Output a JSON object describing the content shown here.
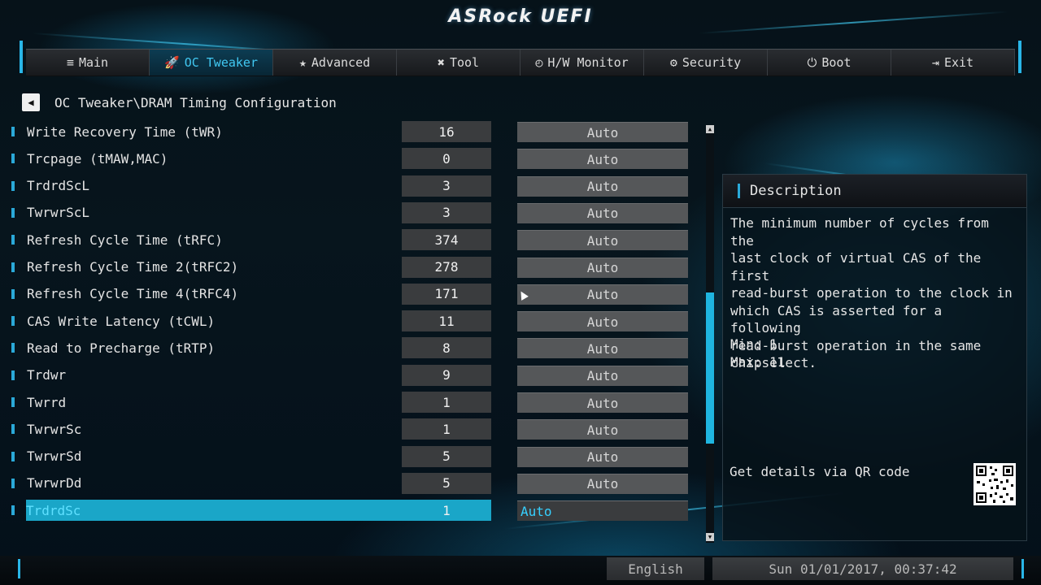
{
  "header": {
    "logo": "ASRock UEFI"
  },
  "tabs": [
    {
      "label": "Main",
      "icon": "≡",
      "active": false
    },
    {
      "label": "OC Tweaker",
      "icon": "🚀",
      "active": true
    },
    {
      "label": "Advanced",
      "icon": "★",
      "active": false
    },
    {
      "label": "Tool",
      "icon": "✖",
      "active": false
    },
    {
      "label": "H/W Monitor",
      "icon": "◴",
      "active": false
    },
    {
      "label": "Security",
      "icon": "⚙",
      "active": false
    },
    {
      "label": "Boot",
      "icon": "⏻",
      "active": false
    },
    {
      "label": "Exit",
      "icon": "⇥",
      "active": false
    }
  ],
  "breadcrumb": {
    "path": "OC Tweaker\\DRAM Timing Configuration"
  },
  "settings": [
    {
      "label": "Write Recovery Time (tWR)",
      "value": "16",
      "option": "Auto"
    },
    {
      "label": "Trcpage (tMAW,MAC)",
      "value": "0",
      "option": "Auto"
    },
    {
      "label": "TrdrdScL",
      "value": "3",
      "option": "Auto"
    },
    {
      "label": "TwrwrScL",
      "value": "3",
      "option": "Auto"
    },
    {
      "label": "Refresh Cycle Time  (tRFC)",
      "value": "374",
      "option": "Auto"
    },
    {
      "label": "Refresh Cycle Time 2(tRFC2)",
      "value": "278",
      "option": "Auto"
    },
    {
      "label": "Refresh Cycle Time 4(tRFC4)",
      "value": "171",
      "option": "Auto"
    },
    {
      "label": "CAS Write Latency (tCWL)",
      "value": "11",
      "option": "Auto"
    },
    {
      "label": "Read to Precharge (tRTP)",
      "value": "8",
      "option": "Auto"
    },
    {
      "label": "Trdwr",
      "value": "9",
      "option": "Auto"
    },
    {
      "label": "Twrrd",
      "value": "1",
      "option": "Auto"
    },
    {
      "label": "TwrwrSc",
      "value": "1",
      "option": "Auto"
    },
    {
      "label": "TwrwrSd",
      "value": "5",
      "option": "Auto"
    },
    {
      "label": "TwrwrDd",
      "value": "5",
      "option": "Auto"
    },
    {
      "label": "TrdrdSc",
      "value": "1",
      "option": "Auto",
      "selected": true
    }
  ],
  "description": {
    "title": "Description",
    "text": "The minimum number of cycles from the\nlast clock of virtual CAS of the first\nread-burst operation to the clock in\nwhich CAS is asserted for a following\nread-burst operation in the same\nchipselect.",
    "min": "Min: 1",
    "max": "Max: 11",
    "qr_text": "Get details via QR code"
  },
  "footer": {
    "language": "English",
    "datetime": "Sun 01/01/2017, 00:37:42"
  },
  "colors": {
    "accent": "#29b6e8",
    "selected_row": "#1aa6c8"
  }
}
